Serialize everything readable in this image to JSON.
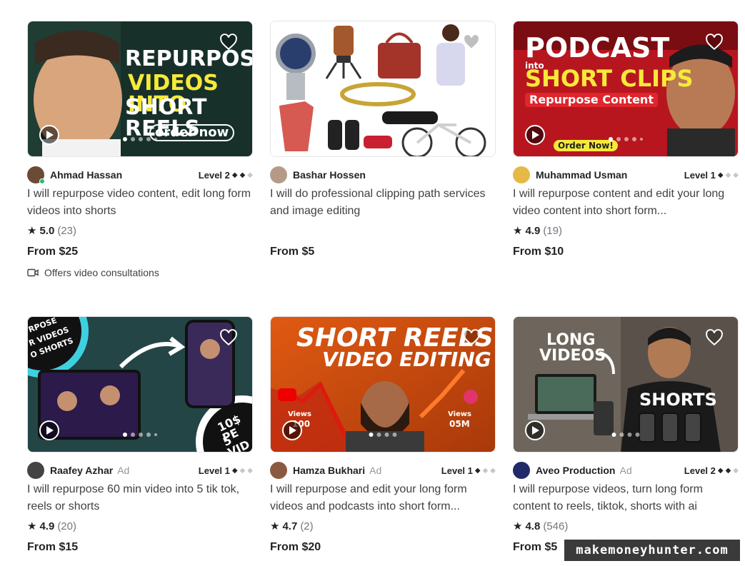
{
  "gigs": [
    {
      "seller": "Ahmad Hassan",
      "ad": "",
      "level": "Level 2",
      "title": "I will repurpose video content, edit long form videos into shorts",
      "rating": "5.0",
      "reviews": "(23)",
      "price": "From $25",
      "consultation": "Offers video consultations",
      "thumb_text": [
        "REPURPOSE",
        "VIDEOS INTO",
        "SHORT REELS",
        "order now"
      ]
    },
    {
      "seller": "Bashar Hossen",
      "ad": "",
      "level": "",
      "title": "I will do professional clipping path services and image editing",
      "rating": "",
      "reviews": "",
      "price": "From $5"
    },
    {
      "seller": "Muhammad Usman",
      "ad": "",
      "level": "Level 1",
      "title": "I will repurpose content and edit your long video content into short form...",
      "rating": "4.9",
      "reviews": "(19)",
      "price": "From $10",
      "thumb_text": [
        "PODCAST",
        "into",
        "SHORT CLIPS",
        "Repurpose Content",
        "Order Now!"
      ]
    },
    {
      "seller": "Raafey Azhar",
      "ad": "Ad",
      "level": "Level 1",
      "title": "I will repurpose 60 min video into 5 tik tok, reels or shorts",
      "rating": "4.9",
      "reviews": "(20)",
      "price": "From $15",
      "thumb_text": [
        "RPOSE",
        "R VIDEOS",
        "O SHORTS",
        "10$ PE",
        "5 VID"
      ]
    },
    {
      "seller": "Hamza Bukhari",
      "ad": "Ad",
      "level": "Level 1",
      "title": "I will repurpose and edit your long form videos and podcasts into short form...",
      "rating": "4.7",
      "reviews": "(2)",
      "price": "From $20",
      "thumb_text": [
        "SHORT REELS",
        "VIDEO EDITING",
        "Views",
        "100",
        "Views",
        "05M"
      ]
    },
    {
      "seller": "Aveo Production",
      "ad": "Ad",
      "level": "Level 2",
      "title": "I will repurpose videos, turn long form content to reels, tiktok, shorts with ai",
      "rating": "4.8",
      "reviews": "(546)",
      "price": "From $5",
      "thumb_text": [
        "LONG",
        "VIDEOS",
        "SHORTS"
      ]
    }
  ],
  "watermark": "makemoneyhunter.com",
  "colors": {
    "accent": "#1dbf73",
    "text": "#404145",
    "muted": "#74767e",
    "heading": "#222325"
  }
}
